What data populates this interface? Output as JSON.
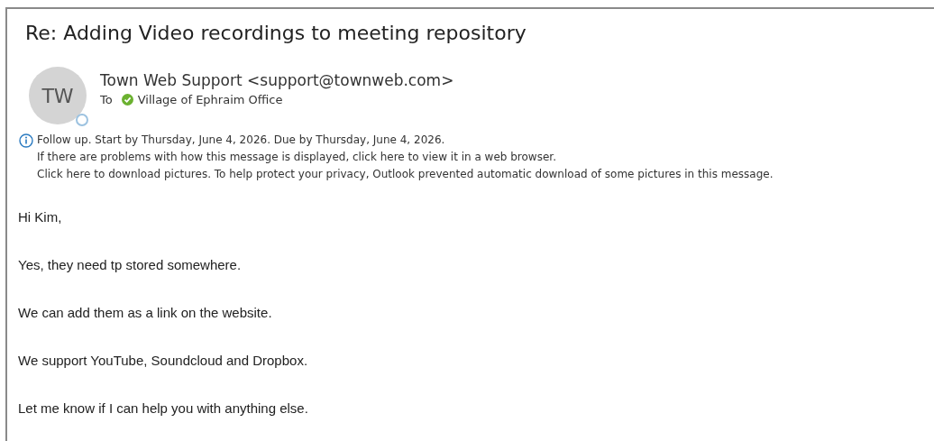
{
  "subject": "Re: Adding Video recordings to meeting repository",
  "sender": {
    "initials": "TW",
    "name": "Town Web Support <support@townweb.com>"
  },
  "recipients": {
    "label": "To",
    "names": [
      "Village of Ephraim Office"
    ]
  },
  "info_lines": [
    "Follow up.  Start by Thursday, June 4, 2026.  Due by Thursday, June 4, 2026.",
    "If there are problems with how this message is displayed, click here to view it in a web browser.",
    "Click here to download pictures. To help protect your privacy, Outlook prevented automatic download of some pictures in this message."
  ],
  "body": [
    "Hi Kim,",
    "Yes, they need tp stored somewhere.",
    "We can add them as a link on the website.",
    "We support YouTube, Soundcloud and Dropbox.",
    "Let me know if I can help you with anything else."
  ]
}
